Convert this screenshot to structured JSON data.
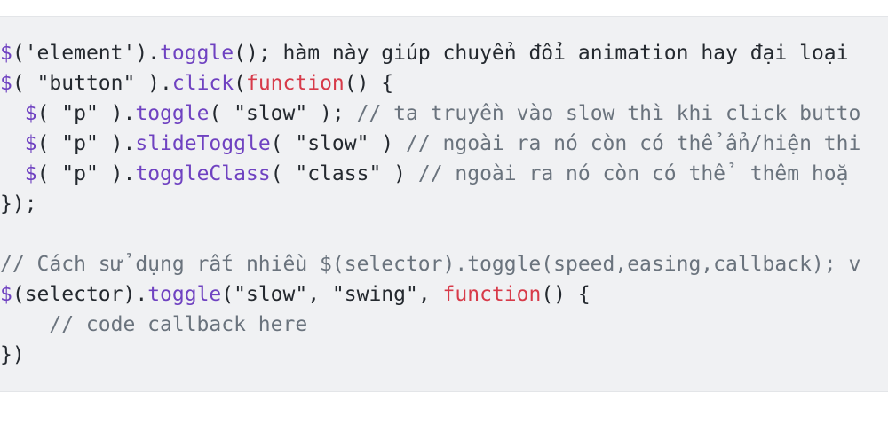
{
  "code_lines": [
    [
      {
        "t": "$",
        "k": "fn"
      },
      {
        "t": "('element').",
        "k": "pl"
      },
      {
        "t": "toggle",
        "k": "fn"
      },
      {
        "t": "(); hàm này giúp chuyển đổi animation hay đại loại",
        "k": "pl"
      }
    ],
    [
      {
        "t": "$",
        "k": "fn"
      },
      {
        "t": "( \"button\" ).",
        "k": "pl"
      },
      {
        "t": "click",
        "k": "fn"
      },
      {
        "t": "(",
        "k": "pl"
      },
      {
        "t": "function",
        "k": "kw"
      },
      {
        "t": "() {",
        "k": "pl"
      }
    ],
    [
      {
        "t": "  ",
        "k": "pl"
      },
      {
        "t": "$",
        "k": "fn"
      },
      {
        "t": "( \"p\" ).",
        "k": "pl"
      },
      {
        "t": "toggle",
        "k": "fn"
      },
      {
        "t": "( \"slow\" ); ",
        "k": "pl"
      },
      {
        "t": "// ta truyền vào slow thì khi click butto",
        "k": "cm"
      }
    ],
    [
      {
        "t": "  ",
        "k": "pl"
      },
      {
        "t": "$",
        "k": "fn"
      },
      {
        "t": "( \"p\" ).",
        "k": "pl"
      },
      {
        "t": "slideToggle",
        "k": "fn"
      },
      {
        "t": "( \"slow\" ) ",
        "k": "pl"
      },
      {
        "t": "// ngoài ra nó còn có thể ẩn/hiện thi",
        "k": "cm"
      }
    ],
    [
      {
        "t": "  ",
        "k": "pl"
      },
      {
        "t": "$",
        "k": "fn"
      },
      {
        "t": "( \"p\" ).",
        "k": "pl"
      },
      {
        "t": "toggleClass",
        "k": "fn"
      },
      {
        "t": "( \"class\" ) ",
        "k": "pl"
      },
      {
        "t": "// ngoài ra nó còn có thể  thêm hoặ",
        "k": "cm"
      }
    ],
    [
      {
        "t": "});",
        "k": "pl"
      }
    ],
    [],
    [
      {
        "t": "// Cách sử dụng rất nhiều $(selector).toggle(speed,easing,callback); v",
        "k": "cm"
      }
    ],
    [
      {
        "t": "$",
        "k": "fn"
      },
      {
        "t": "(selector).",
        "k": "pl"
      },
      {
        "t": "toggle",
        "k": "fn"
      },
      {
        "t": "(\"slow\", \"swing\", ",
        "k": "pl"
      },
      {
        "t": "function",
        "k": "kw"
      },
      {
        "t": "() {",
        "k": "pl"
      }
    ],
    [
      {
        "t": "    ",
        "k": "pl"
      },
      {
        "t": "// code callback here",
        "k": "cm"
      }
    ],
    [
      {
        "t": "})",
        "k": "pl"
      }
    ]
  ],
  "colors": {
    "function_name": "#6f42c1",
    "keyword": "#d73a49",
    "comment": "#6a737d",
    "plain": "#24292f",
    "background": "#f0f1f3"
  }
}
